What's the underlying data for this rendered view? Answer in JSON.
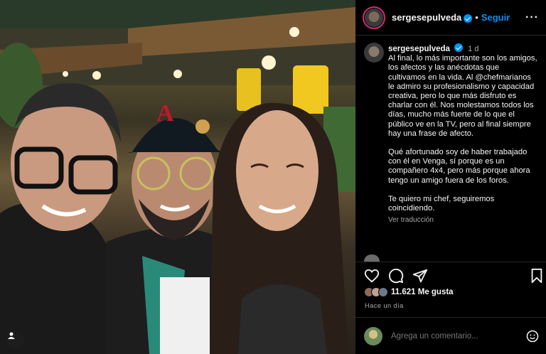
{
  "header": {
    "username": "sergesepulveda",
    "follow_label": "Seguir",
    "more_icon": "more-options-icon"
  },
  "caption": {
    "username": "sergesepulveda",
    "time": "1 d",
    "paragraphs": [
      "Al final, lo más importante son los amigos, los afectos y las anécdotas que cultivamos en la vida. Al @chefmarianos le admiro su profesionalismo y capacidad creativa, pero lo que más disfruto es charlar con él. Nos molestamos todos los días, mucho más fuerte de lo que el público ve en la TV, pero al final siempre hay una frase de afecto.",
      "Qué afortunado soy de haber trabajado con él en Venga, sí porque es un compañero 4x4, pero más porque ahora tengo un amigo fuera de los foros.",
      "Te quiero mi chef, seguiremos coincidiendo."
    ],
    "translate_label": "Ver traducción"
  },
  "actions": {
    "icons": [
      "heart-icon",
      "comment-icon",
      "share-icon",
      "bookmark-icon"
    ]
  },
  "likes": {
    "text": "11.621 Me gusta"
  },
  "posted": {
    "text": "Hace un día"
  },
  "comment": {
    "placeholder": "Agrega un comentario..."
  },
  "colors": {
    "accent": "#0095f6",
    "background": "#000000",
    "text": "#f5f5f5",
    "muted": "#a8a8a8"
  }
}
